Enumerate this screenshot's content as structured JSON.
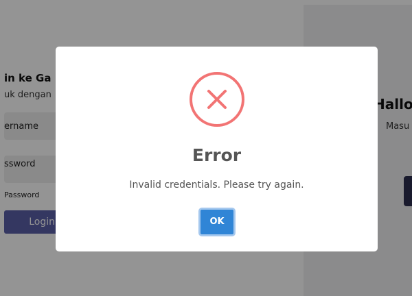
{
  "background": {
    "login_title": "in ke Ga",
    "login_subtitle": "uk dengan",
    "username_label": "ername",
    "password_label": "ssword",
    "forgot_text": "Password",
    "login_button": "Login",
    "right_title": "Hallo",
    "right_subtitle": "Masu"
  },
  "modal": {
    "icon": "error-x-icon",
    "title": "Error",
    "message": "Invalid credentials. Please try again.",
    "ok_button": "OK"
  },
  "colors": {
    "error_red": "#f27474",
    "ok_blue": "#3085d6",
    "login_button": "#5b5fa8"
  }
}
